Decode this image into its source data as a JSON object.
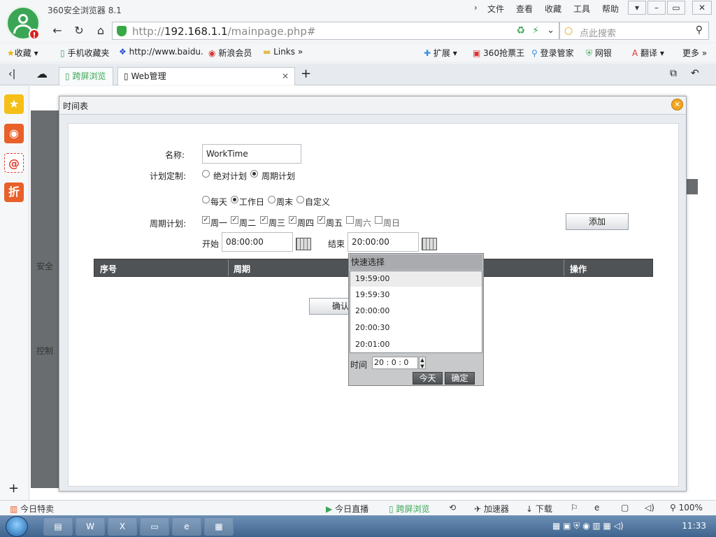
{
  "browser": {
    "title": "360安全浏览器 8.1",
    "menu": [
      "文件",
      "查看",
      "收藏",
      "工具",
      "帮助"
    ],
    "url_prefix": "http://",
    "url_host": "192.168.1.1",
    "url_path": "/mainpage.php#",
    "search_placeholder": "点此搜索",
    "bookmarks": [
      "收藏",
      "手机收藏夹",
      "http://www.baidu.",
      "新浪会员",
      "Links",
      "扩展",
      "360抢票王",
      "登录管家",
      "网银",
      "翻译",
      "更多"
    ],
    "tabs": [
      "跨屏浏览",
      "Web管理"
    ]
  },
  "page": {
    "labels": [
      "安全",
      "控制"
    ]
  },
  "dialog": {
    "title": "时间表",
    "name_label": "名称:",
    "name_value": "WorkTime",
    "plan_label": "计划定制:",
    "plan_options": [
      "绝对计划",
      "周期计划"
    ],
    "preset_options": [
      "每天",
      "工作日",
      "周末",
      "自定义"
    ],
    "cycle_label": "周期计划:",
    "weekdays": [
      {
        "label": "周一",
        "checked": true
      },
      {
        "label": "周二",
        "checked": true
      },
      {
        "label": "周三",
        "checked": true
      },
      {
        "label": "周四",
        "checked": true
      },
      {
        "label": "周五",
        "checked": true
      },
      {
        "label": "周六",
        "checked": false
      },
      {
        "label": "周日",
        "checked": false
      }
    ],
    "add_button": "添加",
    "start_label": "开始",
    "start_value": "08:00:00",
    "end_label": "结束",
    "end_value": "20:00:00",
    "table_headers": [
      "序号",
      "周期",
      "操作"
    ],
    "confirm_button": "确认"
  },
  "time_picker": {
    "header": "快速选择",
    "options": [
      "19:59:00",
      "19:59:30",
      "20:00:00",
      "20:00:30",
      "20:01:00"
    ],
    "time_label": "时间",
    "time_value": "20 :  0  :  0",
    "today_button": "今天",
    "ok_button": "确定"
  },
  "statusbar": {
    "left": "今日特卖",
    "items": [
      "今日直播",
      "跨屏浏览",
      "加速器",
      "下载"
    ],
    "zoom": "100%"
  },
  "taskbar": {
    "clock": "11:33"
  }
}
